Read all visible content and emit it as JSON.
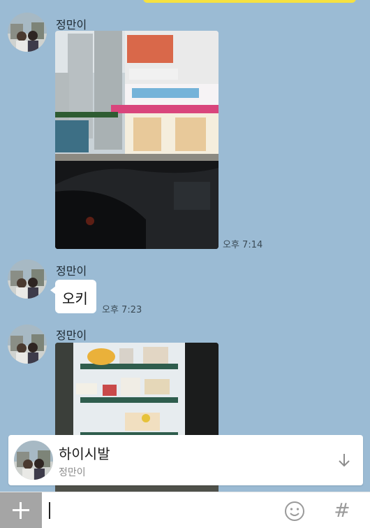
{
  "messages": [
    {
      "sender": "정만이",
      "type": "photo",
      "time": "오후 7:14"
    },
    {
      "sender": "정만이",
      "type": "text",
      "text": "오키",
      "time": "오후 7:23"
    },
    {
      "sender": "정만이",
      "type": "photo"
    }
  ],
  "notice": {
    "title": "하이시발",
    "sender": "정만이",
    "icon": "arrow-down-icon"
  },
  "input_bar": {
    "value": "",
    "icons": [
      "plus-icon",
      "emoji-icon",
      "hash-icon"
    ],
    "hash_glyph": "#"
  },
  "colors": {
    "chat_background": "#9bbbd4",
    "bubble": "#ffffff",
    "accent_yellow": "#f5e141"
  }
}
